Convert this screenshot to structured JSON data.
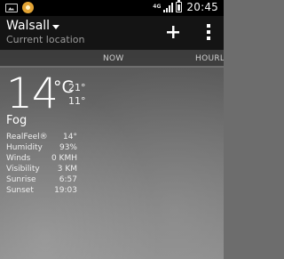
{
  "statusbar": {
    "network": "4G",
    "time": "20:45"
  },
  "actionbar": {
    "city": "Walsall",
    "subtitle": "Current location"
  },
  "tabs": [
    {
      "label": "NOW"
    },
    {
      "label": "HOURL"
    }
  ],
  "current": {
    "temperature": "14",
    "unit": "°C",
    "high": "21°",
    "low": "11°",
    "condition": "Fog"
  },
  "details": [
    {
      "label": "RealFeel®",
      "value": "14°"
    },
    {
      "label": "Humidity",
      "value": "93%"
    },
    {
      "label": "Winds",
      "value": "0 KMH"
    },
    {
      "label": "Visibility",
      "value": "3 KM"
    },
    {
      "label": "Sunrise",
      "value": "6:57"
    },
    {
      "label": "Sunset",
      "value": "19:03"
    }
  ]
}
